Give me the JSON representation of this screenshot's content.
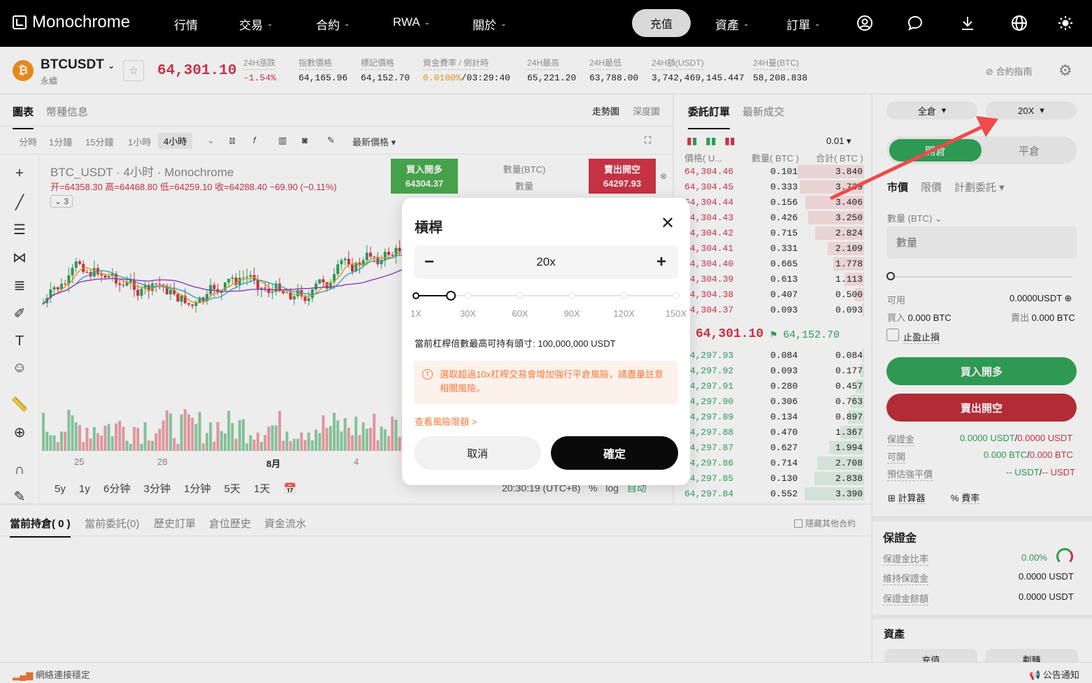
{
  "brand": "Monochrome",
  "nav": {
    "items": [
      "行情",
      "交易",
      "合約",
      "RWA",
      "關於"
    ],
    "deposit": "充值",
    "right_items": [
      "資產",
      "訂單"
    ],
    "icons": [
      "user-icon",
      "chat-icon",
      "download-icon",
      "globe-icon",
      "sun-icon"
    ]
  },
  "ticker": {
    "symbol": "BTCUSDT",
    "sub": "永續",
    "last_price": "64,301.10",
    "stats": [
      {
        "label": "24H漲跌",
        "value": "-1.54%"
      },
      {
        "label": "指數價格",
        "value": "64,165.96"
      },
      {
        "label": "標記價格",
        "value": "64,152.70"
      },
      {
        "label": "資金費率 / 倒計時",
        "value_a": "0.0100%",
        "value_b": "/03:29:40"
      },
      {
        "label": "24H最高",
        "value": "65,221.20"
      },
      {
        "label": "24H最低",
        "value": "63,788.00"
      },
      {
        "label": "24H額(USDT)",
        "value": "3,742,469,145.447"
      },
      {
        "label": "24H量(BTC)",
        "value": "58,208.838"
      }
    ],
    "guide": "合約指南"
  },
  "chart": {
    "tabs": [
      "圖表",
      "幣種信息"
    ],
    "view_tabs": [
      "走勢圖",
      "深度圖"
    ],
    "timeframes": [
      "分時",
      "1分鐘",
      "15分鐘",
      "1小時",
      "4小時"
    ],
    "price_type": "最新價格",
    "title": "BTC_USDT · 4小时 · Monochrome",
    "ohlc": "开=64358.30  高=64468.80  低=64259.10  收=64288.40  −69.90 (−0.11%)",
    "indicator_count": "3",
    "buy_label": "買入開多",
    "buy_price": "64304.37",
    "sell_label": "賣出開空",
    "sell_price": "64297.93",
    "qty_label": "數量(BTC)",
    "qty_placeholder": "數量",
    "x_labels": [
      "25",
      "28",
      "8月",
      "4"
    ],
    "ranges": [
      "5y",
      "1y",
      "6分钟",
      "3分钟",
      "1分钟",
      "5天",
      "1天"
    ],
    "clock": "20:30:19 (UTC+8)",
    "pct": "%",
    "log": "log",
    "auto": "自动"
  },
  "book": {
    "tabs": [
      "委託訂單",
      "最新成交"
    ],
    "precision": "0.01",
    "headers": [
      "價格( U...",
      "數量( BTC )",
      "合計( BTC )"
    ],
    "asks": [
      [
        "64,304.46",
        "0.101",
        "3.840",
        0.95
      ],
      [
        "64,304.45",
        "0.333",
        "3.739",
        0.92
      ],
      [
        "64,304.44",
        "0.156",
        "3.406",
        0.84
      ],
      [
        "64,304.43",
        "0.426",
        "3.250",
        0.8
      ],
      [
        "64,304.42",
        "0.715",
        "2.824",
        0.7
      ],
      [
        "64,304.41",
        "0.331",
        "2.109",
        0.52
      ],
      [
        "64,304.40",
        "0.665",
        "1.778",
        0.44
      ],
      [
        "64,304.39",
        "0.613",
        "1.113",
        0.28
      ],
      [
        "64,304.38",
        "0.407",
        "0.500",
        0.13
      ],
      [
        "64,304.37",
        "0.093",
        "0.093",
        0.03
      ]
    ],
    "mid_price": "64,301.10",
    "mark_price": "64,152.70",
    "bids": [
      [
        "64,297.93",
        "0.084",
        "0.084",
        0.03
      ],
      [
        "64,297.92",
        "0.093",
        "0.177",
        0.05
      ],
      [
        "64,297.91",
        "0.280",
        "0.457",
        0.12
      ],
      [
        "64,297.90",
        "0.306",
        "0.763",
        0.19
      ],
      [
        "64,297.89",
        "0.134",
        "0.897",
        0.23
      ],
      [
        "64,297.88",
        "0.470",
        "1.367",
        0.34
      ],
      [
        "64,297.87",
        "0.627",
        "1.994",
        0.5
      ],
      [
        "64,297.86",
        "0.714",
        "2.708",
        0.67
      ],
      [
        "64,297.85",
        "0.130",
        "2.838",
        0.71
      ],
      [
        "64,297.84",
        "0.552",
        "3.390",
        0.85
      ]
    ]
  },
  "trade": {
    "margin_mode": "全倉",
    "leverage": "20X",
    "open_tab": "開倉",
    "close_tab": "平倉",
    "order_types": [
      "市價",
      "限價",
      "計劃委託"
    ],
    "qty_label": "數量 (BTC)",
    "qty_placeholder": "數量",
    "available_label": "可用",
    "available_value": "0.0000USDT",
    "buy_label": "買入",
    "buy_value": "0.000 BTC",
    "sell_label": "賣出",
    "sell_value": "0.000 BTC",
    "tpsl": "止盈止損",
    "buy_btn": "買入開多",
    "sell_btn": "賣出開空",
    "margin_label": "保證金",
    "margin_value_a": "0.0000 USDT",
    "margin_value_b": "0.0000 USDT",
    "avail_label": "可開",
    "avail_value_a": "0.000 BTC",
    "avail_value_b": "0.000 BTC",
    "liq_label": "預估強平價",
    "liq_value_a": "-- USDT",
    "liq_value_b": "-- USDT",
    "calc": "計算器",
    "rate": "費率",
    "margin_section": "保證金",
    "margin_ratio_label": "保證金比率",
    "margin_ratio_value": "0.00%",
    "maint_label": "維持保證金",
    "maint_value": "0.0000 USDT",
    "balance_label": "保證金餘額",
    "balance_value": "0.0000 USDT",
    "assets_section": "資產",
    "deposit": "充值",
    "transfer": "劃轉"
  },
  "positions": {
    "tabs": [
      "當前持倉( 0 )",
      "當前委託(0)",
      "歷史訂單",
      "倉位歷史",
      "資金流水"
    ],
    "hide_other": "隱藏其他合約"
  },
  "status": {
    "connection": "網絡連接穩定",
    "notice": "公告通知"
  },
  "modal": {
    "title": "槓桿",
    "value": "20x",
    "slider_fraction": 0.1333,
    "ticks": [
      "1X",
      "30X",
      "60X",
      "90X",
      "120X",
      "150X"
    ],
    "max_note": "當前杠桿倍數最高可持有頭寸:  100,000,000 USDT",
    "warning": "選取超過10x杠桿交易會增加強行平倉風險，請盡量註意相關風險。",
    "risk_link": "查看風險限額 >",
    "cancel": "取消",
    "confirm": "確定"
  },
  "colors": {
    "up": "#32a55a",
    "down": "#d4364a",
    "warn": "#f07a3c",
    "arrow": "#f04a4a"
  }
}
